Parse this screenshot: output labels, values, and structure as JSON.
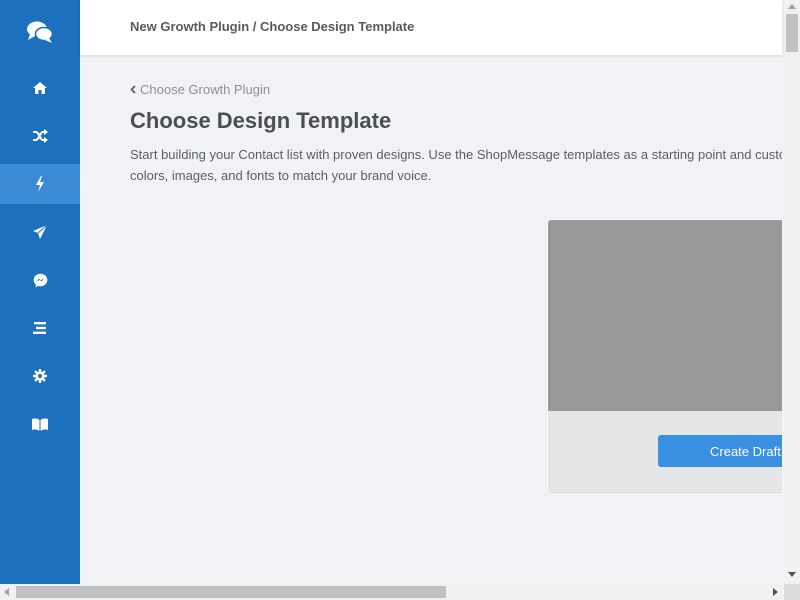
{
  "colors": {
    "sidebar": "#1d70bd",
    "sidebar_active": "#3b8bd4",
    "primary_button": "#3a90e0",
    "background": "#f1f2f6",
    "template_preview": "#98999b"
  },
  "sidebar": {
    "logo_icon": "chat-bubbles-icon",
    "items": [
      {
        "icon": "home-icon",
        "active": false
      },
      {
        "icon": "shuffle-icon",
        "active": false
      },
      {
        "icon": "lightning-icon",
        "active": true
      },
      {
        "icon": "paper-plane-icon",
        "active": false
      },
      {
        "icon": "messenger-icon",
        "active": false
      },
      {
        "icon": "list-icon",
        "active": false
      },
      {
        "icon": "gear-icon",
        "active": false
      },
      {
        "icon": "book-icon",
        "active": false
      }
    ]
  },
  "header": {
    "breadcrumb": "New Growth Plugin / Choose Design Template"
  },
  "main": {
    "back_link": "Choose Growth Plugin",
    "title": "Choose Design Template",
    "description": "Start building your Contact list with proven designs. Use the ShopMessage templates as a starting point and customize colors, images, and fonts to match your brand voice."
  },
  "template_card": {
    "button_label": "Create Draft"
  }
}
